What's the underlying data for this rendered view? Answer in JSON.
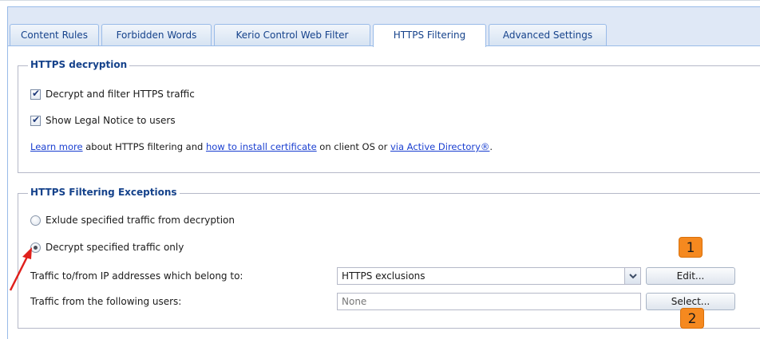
{
  "tabs": [
    {
      "label": "Content Rules",
      "active": false
    },
    {
      "label": "Forbidden Words",
      "active": false
    },
    {
      "label": "Kerio Control Web Filter",
      "active": false
    },
    {
      "label": "HTTPS Filtering",
      "active": true
    },
    {
      "label": "Advanced Settings",
      "active": false
    }
  ],
  "decryption": {
    "legend": "HTTPS decryption",
    "decrypt_label": "Decrypt and filter HTTPS traffic",
    "decrypt_checked": true,
    "legal_label": "Show Legal Notice to users",
    "legal_checked": true,
    "info": {
      "link1": "Learn more",
      "text1": " about HTTPS filtering and ",
      "link2": "how to install certificate",
      "text2": " on client OS or ",
      "link3": "via Active Directory®",
      "text3": "."
    }
  },
  "exceptions": {
    "legend": "HTTPS Filtering Exceptions",
    "exclude_label": "Exlude specified traffic from decryption",
    "exclude_selected": false,
    "decrypt_only_label": "Decrypt specified traffic only",
    "decrypt_only_selected": true,
    "ip_label": "Traffic to/from IP addresses which belong to:",
    "ip_value": "HTTPS exclusions",
    "edit_label": "Edit...",
    "users_label": "Traffic from the following users:",
    "users_value": "None",
    "select_label": "Select..."
  },
  "annotations": {
    "badge1": "1",
    "badge2": "2",
    "accent_color": "#f5891f",
    "arrow_color": "#e0201c"
  }
}
